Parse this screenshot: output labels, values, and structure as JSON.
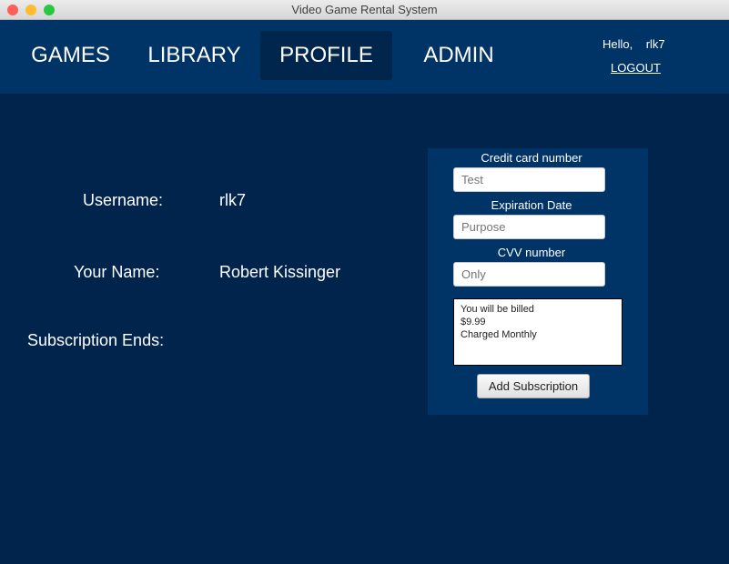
{
  "window": {
    "title": "Video Game Rental System"
  },
  "nav": {
    "items": [
      {
        "label": "GAMES"
      },
      {
        "label": "LIBRARY"
      },
      {
        "label": "PROFILE",
        "active": true
      },
      {
        "label": "ADMIN"
      }
    ]
  },
  "user": {
    "greeting": "Hello,",
    "username": "rlk7",
    "logout": "LOGOUT"
  },
  "profile": {
    "username_label": "Username:",
    "username": "rlk7",
    "name_label": "Your Name:",
    "name": "Robert Kissinger",
    "subscription_label": "Subscription Ends:"
  },
  "payment": {
    "cc_label": "Credit card number",
    "cc_placeholder": "Test",
    "exp_label": "Expiration Date",
    "exp_placeholder": "Purpose",
    "cvv_label": "CVV number",
    "cvv_placeholder": "Only",
    "billing_lines": [
      "You will be billed",
      "$9.99",
      "Charged Monthly"
    ],
    "button": "Add Subscription"
  },
  "colors": {
    "header": "#003366",
    "background": "#00244b",
    "active_tab": "#00264d"
  }
}
